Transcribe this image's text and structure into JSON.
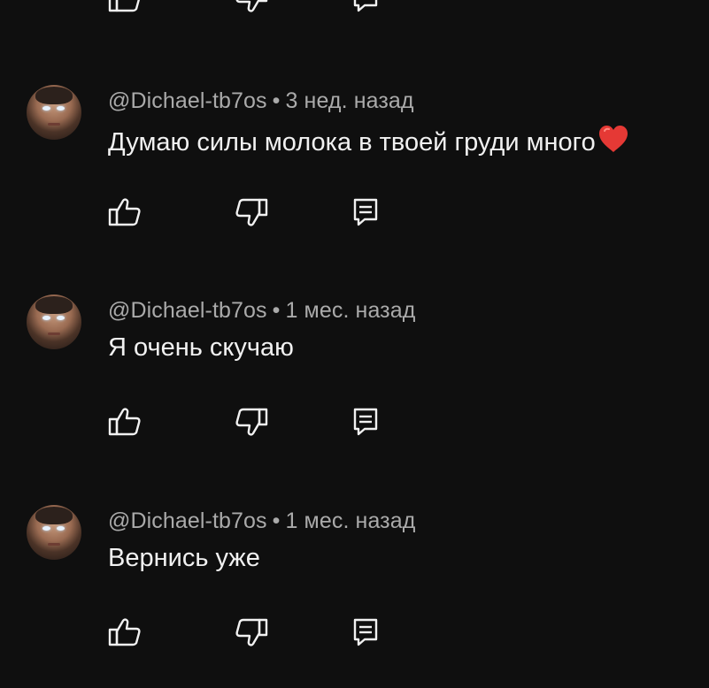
{
  "top_actions": {
    "like_icon": "thumb-up-icon",
    "dislike_icon": "thumb-down-icon",
    "reply_icon": "reply-icon"
  },
  "comments": [
    {
      "author": "@Dichael-tb7os",
      "separator": "•",
      "time": "3 нед. назад",
      "text": "Думаю силы молока в твоей груди много",
      "emoji": "heart-emoji",
      "like_icon": "thumb-up-icon",
      "dislike_icon": "thumb-down-icon",
      "reply_icon": "reply-icon"
    },
    {
      "author": "@Dichael-tb7os",
      "separator": "•",
      "time": "1 мес. назад",
      "text": "Я очень скучаю",
      "like_icon": "thumb-up-icon",
      "dislike_icon": "thumb-down-icon",
      "reply_icon": "reply-icon"
    },
    {
      "author": "@Dichael-tb7os",
      "separator": "•",
      "time": "1 мес. назад",
      "text": "Вернись уже",
      "like_icon": "thumb-up-icon",
      "dislike_icon": "thumb-down-icon",
      "reply_icon": "reply-icon"
    }
  ],
  "colors": {
    "background": "#0f0f0f",
    "text_primary": "#f1f1f1",
    "text_secondary": "#aaaaaa",
    "heart": "#e53935"
  }
}
